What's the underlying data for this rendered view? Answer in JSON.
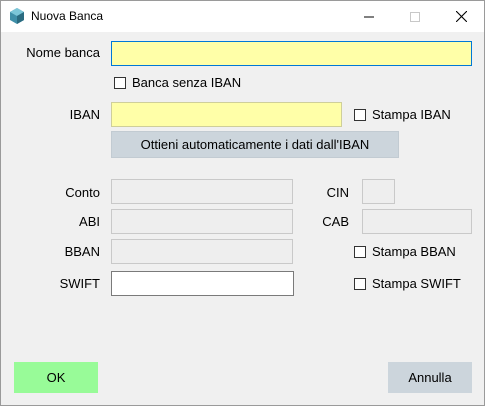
{
  "window": {
    "title": "Nuova Banca",
    "icons": {
      "app": "bank-building-icon",
      "minimize": "minimize-icon",
      "maximize": "maximize-icon",
      "close": "close-icon"
    }
  },
  "form": {
    "nome_banca": {
      "label": "Nome banca",
      "value": ""
    },
    "banca_senza_iban": {
      "label": "Banca senza IBAN",
      "checked": false
    },
    "iban": {
      "label": "IBAN",
      "value": ""
    },
    "stampa_iban": {
      "label": "Stampa IBAN",
      "checked": false
    },
    "auto_button": "Ottieni automaticamente i dati dall'IBAN",
    "conto": {
      "label": "Conto",
      "value": ""
    },
    "cin": {
      "label": "CIN",
      "value": ""
    },
    "abi": {
      "label": "ABI",
      "value": ""
    },
    "cab": {
      "label": "CAB",
      "value": ""
    },
    "bban": {
      "label": "BBAN",
      "value": ""
    },
    "stampa_bban": {
      "label": "Stampa BBAN",
      "checked": false
    },
    "swift": {
      "label": "SWIFT",
      "value": ""
    },
    "stampa_swift": {
      "label": "Stampa SWIFT",
      "checked": false
    }
  },
  "buttons": {
    "ok": "OK",
    "cancel": "Annulla"
  },
  "colors": {
    "required_field": "#ffffa8",
    "focus_border": "#0078d7",
    "ok_button": "#98fb98",
    "neutral_button": "#ccd5dc",
    "disabled_field": "#eeeeee"
  }
}
